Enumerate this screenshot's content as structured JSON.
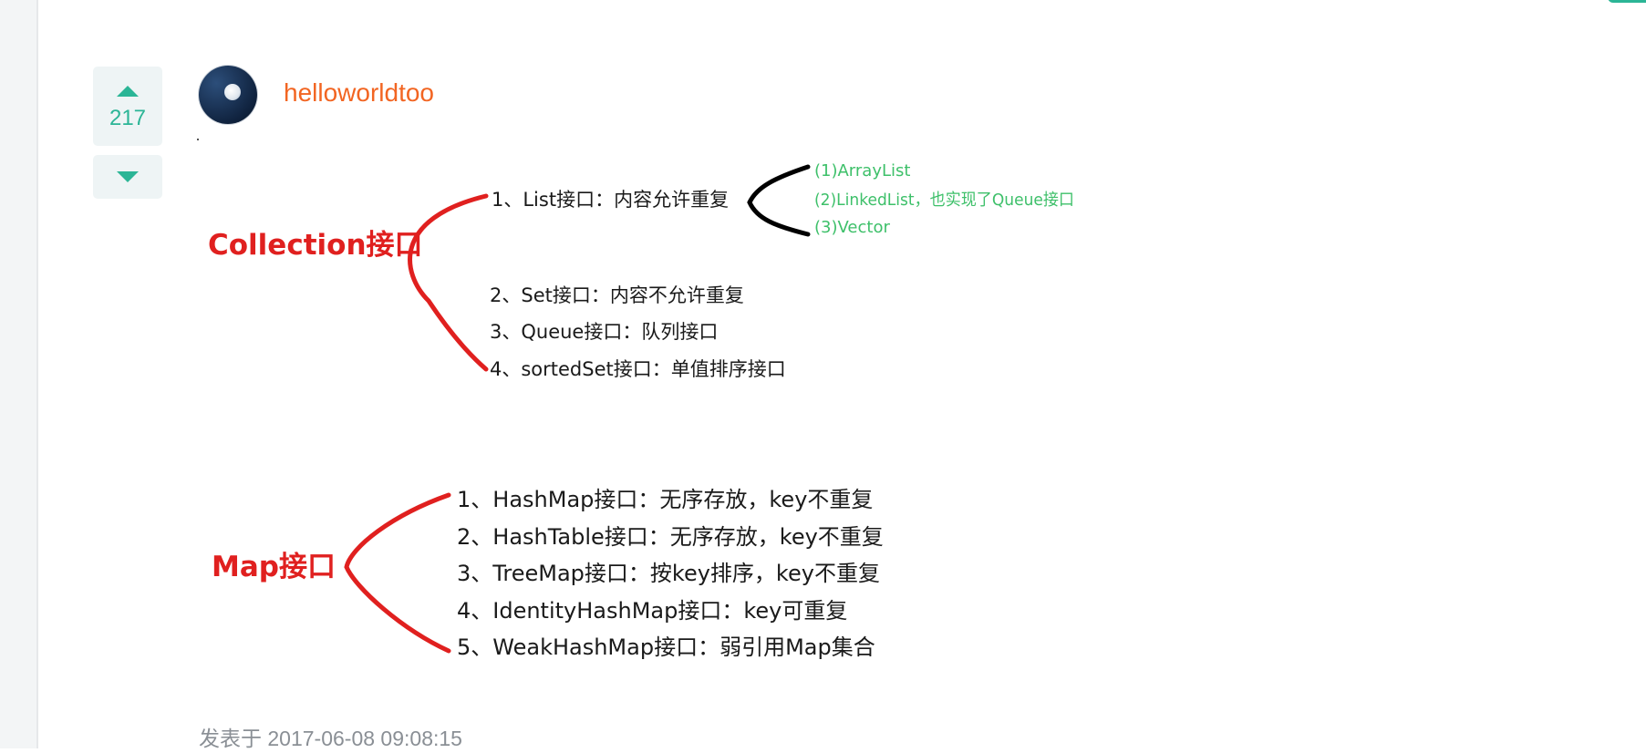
{
  "vote": {
    "count": "217"
  },
  "author": {
    "name": "helloworldtoo"
  },
  "diagram": {
    "collection": {
      "title": "Collection接口",
      "items": [
        "1、List接口：内容允许重复",
        "2、Set接口：内容不允许重复",
        "3、Queue接口：队列接口",
        "4、sortedSet接口：单值排序接口"
      ],
      "list_impls": [
        "(1)ArrayList",
        "(2)LinkedList，也实现了Queue接口",
        "(3)Vector"
      ]
    },
    "map": {
      "title": "Map接口",
      "items": [
        "1、HashMap接口：无序存放，key不重复",
        "2、HashTable接口：无序存放，key不重复",
        "3、TreeMap接口：按key排序，key不重复",
        "4、IdentityHashMap接口：key可重复",
        "5、WeakHashMap接口：弱引用Map集合"
      ]
    }
  },
  "footer": {
    "posted": "发表于 2017-06-08 09:08:15"
  },
  "colors": {
    "accent": "#2bb596",
    "author": "#f26522",
    "bracket_red": "#e0201f",
    "impl_green": "#3ec06a"
  }
}
